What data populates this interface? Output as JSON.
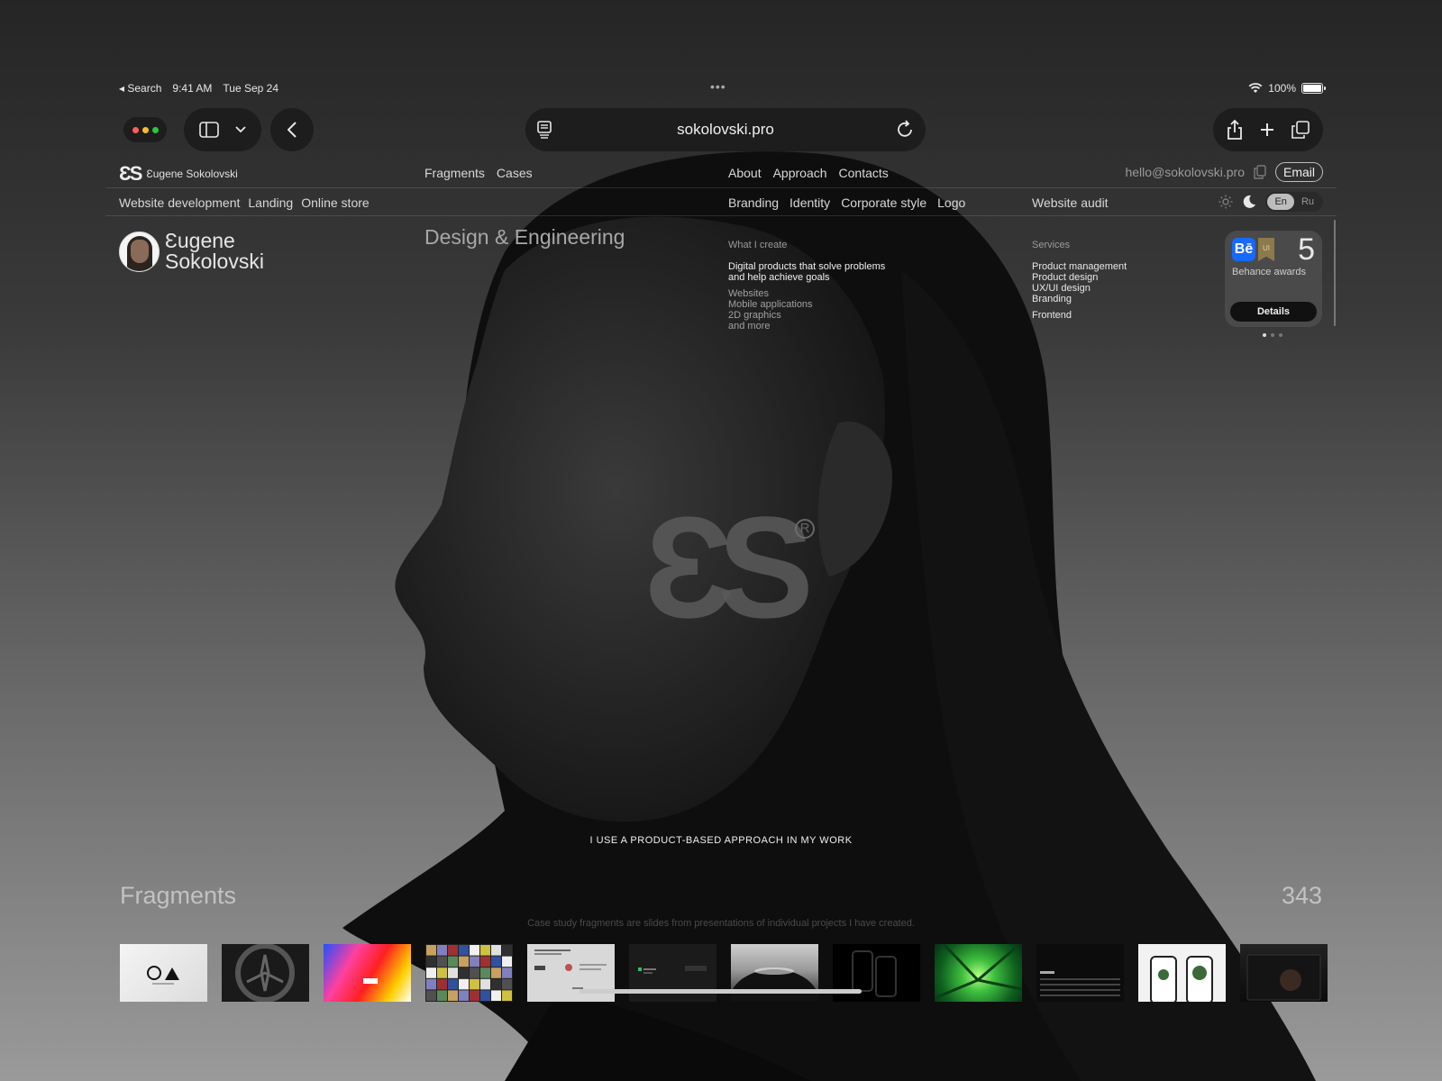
{
  "status_bar": {
    "back_app": "Search",
    "time": "9:41 AM",
    "date": "Tue Sep 24",
    "more": "•••",
    "battery": "100%",
    "battery_level": 1.0
  },
  "browser": {
    "url": "sokolovski.pro",
    "icons": [
      "sidebar-icon",
      "chevron-down-icon",
      "back-icon",
      "tab-reader-icon",
      "reload-icon",
      "share-icon",
      "plus-icon",
      "tabs-icon"
    ],
    "traffic_colors": [
      "#ff5f57",
      "#febc2e",
      "#28c840"
    ]
  },
  "nav": {
    "logo_mark": "ƐS",
    "logo_name": "Ɛugene Sokolovski",
    "primary_left": [
      "Fragments",
      "Cases"
    ],
    "primary_right": [
      "About",
      "Approach",
      "Contacts"
    ],
    "email_address": "hello@sokolovski.pro",
    "email_button": "Email",
    "secondary_left": [
      "Website development",
      "Landing",
      "Online store"
    ],
    "secondary_mid": [
      "Branding",
      "Identity",
      "Corporate style",
      "Logo"
    ],
    "secondary_right": "Website audit",
    "lang": [
      "En",
      "Ru"
    ],
    "lang_selected": "En"
  },
  "hero": {
    "name_line1": "Ɛugene",
    "name_line2": "Sokolovski",
    "tagline": "Design & Engineering",
    "create_heading": "What I create",
    "create_lead_1": "Digital products that solve problems",
    "create_lead_2": "and help achieve goals",
    "create_items": [
      "Websites",
      "Mobile applications",
      "2D graphics",
      "and more"
    ],
    "services_heading": "Services",
    "services_items": [
      "Product management",
      "Product design",
      "UX/UI design",
      "Branding"
    ],
    "services_extra": "Frontend",
    "center_mark": "ƐS",
    "center_reg": "R",
    "approach": "I USE A PRODUCT-BASED APPROACH IN MY WORK"
  },
  "award": {
    "be": "Bē",
    "ui": "UI",
    "count": "5",
    "label": "Behance awards",
    "button": "Details",
    "dots": 3,
    "active_dot": 0
  },
  "fragments": {
    "title": "Fragments",
    "count": "343",
    "description": "Case study fragments are slides from presentations of individual projects I have created.",
    "thumbnails": [
      "fragment-1",
      "fragment-2",
      "fragment-3",
      "fragment-4",
      "fragment-5",
      "fragment-6",
      "fragment-7",
      "fragment-8",
      "fragment-9",
      "fragment-10",
      "fragment-11",
      "fragment-12"
    ]
  }
}
